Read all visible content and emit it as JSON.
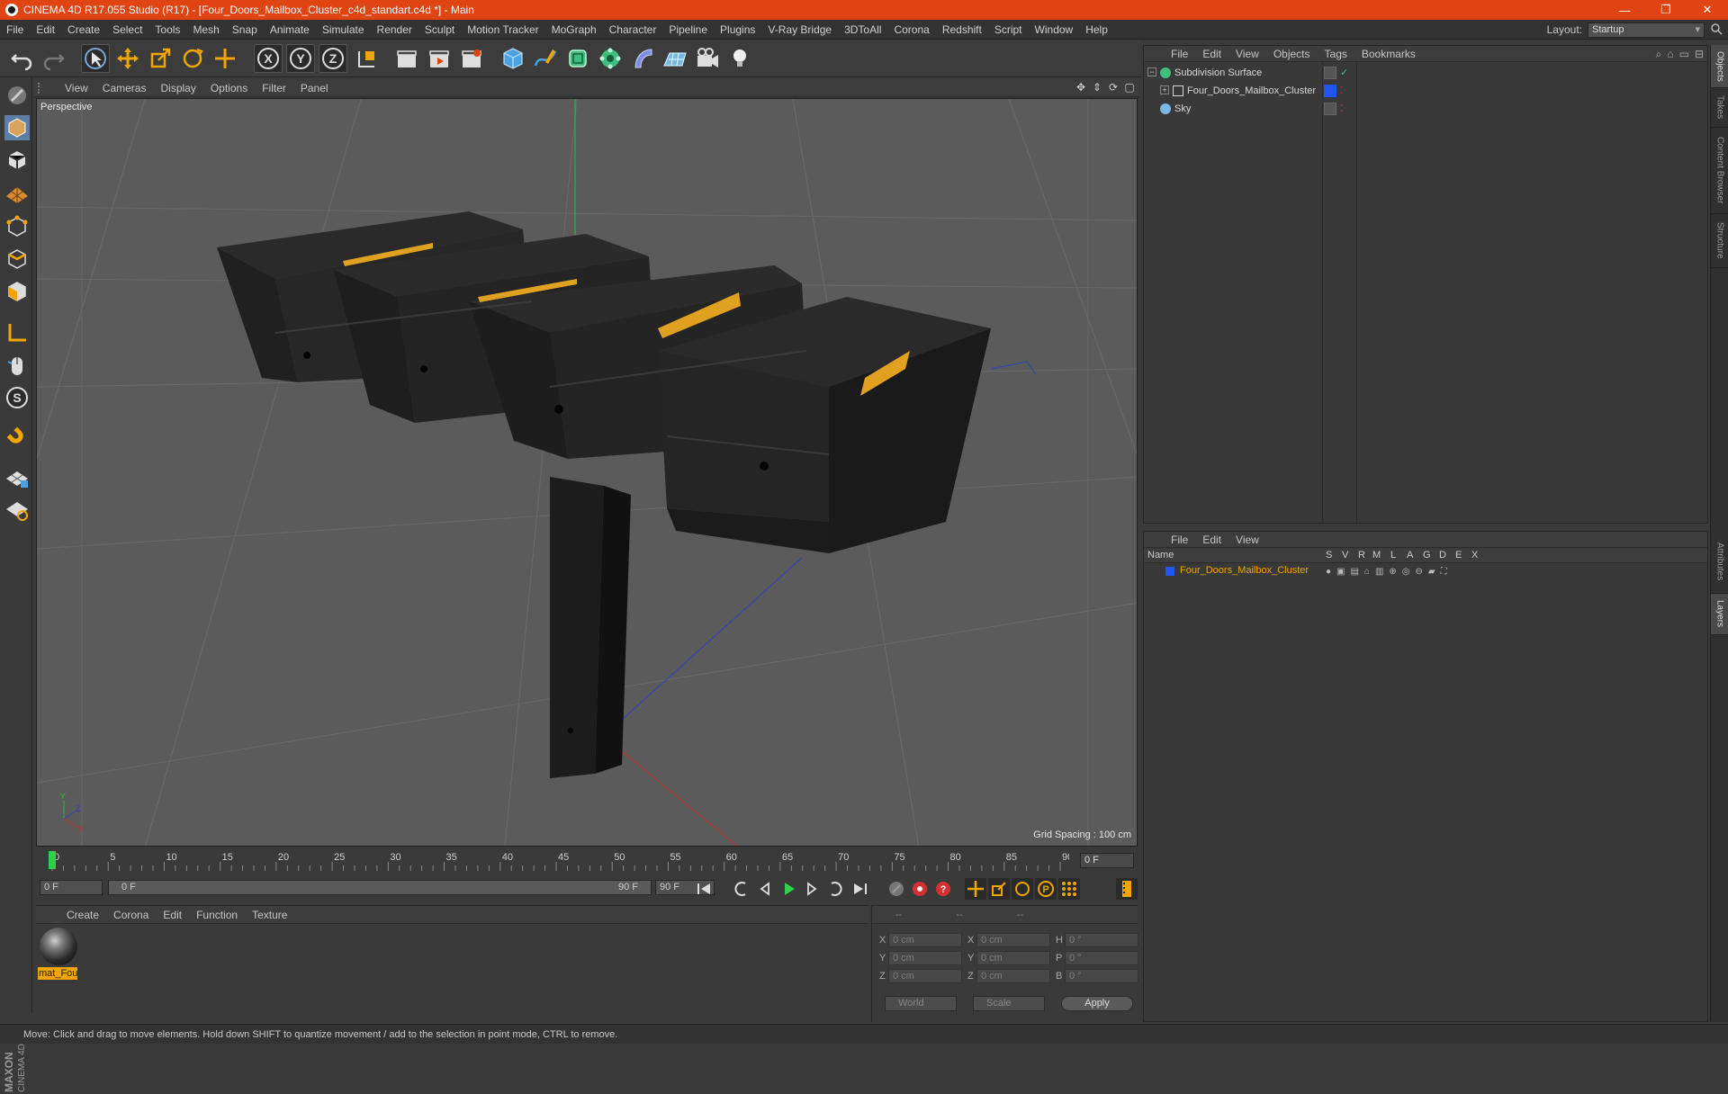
{
  "window": {
    "title": "CINEMA 4D R17.055 Studio (R17) - [Four_Doors_Mailbox_Cluster_c4d_standart.c4d *] - Main",
    "minimize": "—",
    "maximize": "❐",
    "close": "✕"
  },
  "menu": [
    "File",
    "Edit",
    "Create",
    "Select",
    "Tools",
    "Mesh",
    "Snap",
    "Animate",
    "Simulate",
    "Render",
    "Sculpt",
    "Motion Tracker",
    "MoGraph",
    "Character",
    "Pipeline",
    "Plugins",
    "V-Ray Bridge",
    "3DToAll",
    "Corona",
    "Redshift",
    "Script",
    "Window",
    "Help"
  ],
  "layout": {
    "label": "Layout:",
    "value": "Startup"
  },
  "viewport": {
    "menu": [
      "View",
      "Cameras",
      "Display",
      "Options",
      "Filter",
      "Panel"
    ],
    "label": "Perspective",
    "grid_spacing": "Grid Spacing : 100 cm",
    "axis_x": "X",
    "axis_y": "Y",
    "axis_z": "Z"
  },
  "timeline": {
    "ticks": [
      "0",
      "5",
      "10",
      "15",
      "20",
      "25",
      "30",
      "35",
      "40",
      "45",
      "50",
      "55",
      "60",
      "65",
      "70",
      "75",
      "80",
      "85",
      "90"
    ],
    "current_frame": "0 F"
  },
  "transport": {
    "start_field": "0 F",
    "range_start": "0 F",
    "range_end": "90 F",
    "end_field": "90 F"
  },
  "material_panel": {
    "menu": [
      "Create",
      "Corona",
      "Edit",
      "Function",
      "Texture"
    ],
    "material_name": "mat_Fou"
  },
  "coord_panel": {
    "headers": [
      "--",
      "--",
      "--"
    ],
    "rows": [
      {
        "a": "X",
        "av": "0 cm",
        "b": "X",
        "bv": "0 cm",
        "c": "H",
        "cv": "0 °"
      },
      {
        "a": "Y",
        "av": "0 cm",
        "b": "Y",
        "bv": "0 cm",
        "c": "P",
        "cv": "0 °"
      },
      {
        "a": "Z",
        "av": "0 cm",
        "b": "Z",
        "bv": "0 cm",
        "c": "B",
        "cv": "0 °"
      }
    ],
    "world": "World",
    "scale": "Scale",
    "apply": "Apply"
  },
  "object_manager": {
    "menu": [
      "File",
      "Edit",
      "View",
      "Objects",
      "Tags",
      "Bookmarks"
    ],
    "objects": [
      {
        "name": "Subdivision Surface",
        "icon_color": "#3fbf7f",
        "indent": 0
      },
      {
        "name": "Four_Doors_Mailbox_Cluster",
        "icon_color": "#d6d6d6",
        "indent": 1
      },
      {
        "name": "Sky",
        "icon_color": "#7ab8e6",
        "indent": 0
      }
    ]
  },
  "layer_manager": {
    "menu": [
      "File",
      "Edit",
      "View"
    ],
    "columns": [
      "Name",
      "S",
      "V",
      "R",
      "M",
      "L",
      "A",
      "G",
      "D",
      "E",
      "X"
    ],
    "layer_name": "Four_Doors_Mailbox_Cluster",
    "layer_color": "#2255ee"
  },
  "side_tabs": [
    "Objects",
    "Takes",
    "Content Browser",
    "Structure",
    "Attributes",
    "Layers"
  ],
  "status": "Move: Click and drag to move elements. Hold down SHIFT to quantize movement / add to the selection in point mode, CTRL to remove.",
  "brand": {
    "line1": "MAXON",
    "line2": "CINEMA 4D"
  },
  "colors": {
    "title_bar": "#e04412",
    "accent_orange": "#f0a500",
    "viewport_bg": "#5b5b5b"
  }
}
